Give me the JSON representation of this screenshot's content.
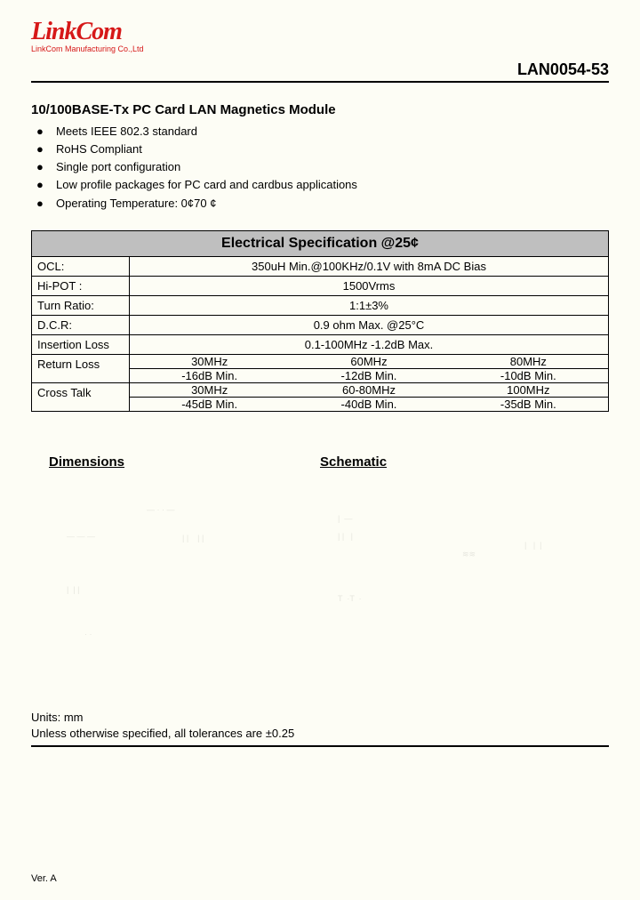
{
  "logo": {
    "main": "LinkCom",
    "sub": "LinkCom Manufacturing Co.,Ltd"
  },
  "part_number": "LAN0054-53",
  "product_title": "10/100BASE-Tx PC Card LAN Magnetics Module",
  "features": [
    "Meets IEEE 802.3 standard",
    "RoHS Compliant",
    "Single port configuration",
    "Low profile packages for PC card and cardbus applications",
    "Operating Temperature: 0¢70   ¢"
  ],
  "spec_title": "Electrical Specification @25¢",
  "specs": {
    "ocl": {
      "label": "OCL:",
      "value": "350uH Min.@100KHz/0.1V with 8mA DC Bias"
    },
    "hipot": {
      "label": "Hi-POT :",
      "value": "1500Vrms"
    },
    "turn": {
      "label": "Turn Ratio:",
      "value": "1:1±3%"
    },
    "dcr": {
      "label": "D.C.R:",
      "value": "0.9 ohm Max. @25°C"
    },
    "iloss": {
      "label": "Insertion Loss",
      "value": "0.1-100MHz   -1.2dB Max."
    },
    "rloss": {
      "label": "Return Loss",
      "freqs": [
        "30MHz",
        "60MHz",
        "80MHz"
      ],
      "vals": [
        "-16dB Min.",
        "-12dB Min.",
        "-10dB Min."
      ]
    },
    "xtalk": {
      "label": "Cross Talk",
      "freqs": [
        "30MHz",
        "60-80MHz",
        "100MHz"
      ],
      "vals": [
        "-45dB Min.",
        "-40dB Min.",
        "-35dB Min."
      ]
    }
  },
  "sections": {
    "dimensions": "Dimensions",
    "schematic": "Schematic"
  },
  "units": {
    "line1": "Units: mm",
    "line2": "Unless otherwise specified, all tolerances are ±0.25"
  },
  "footer": "Ver. A"
}
